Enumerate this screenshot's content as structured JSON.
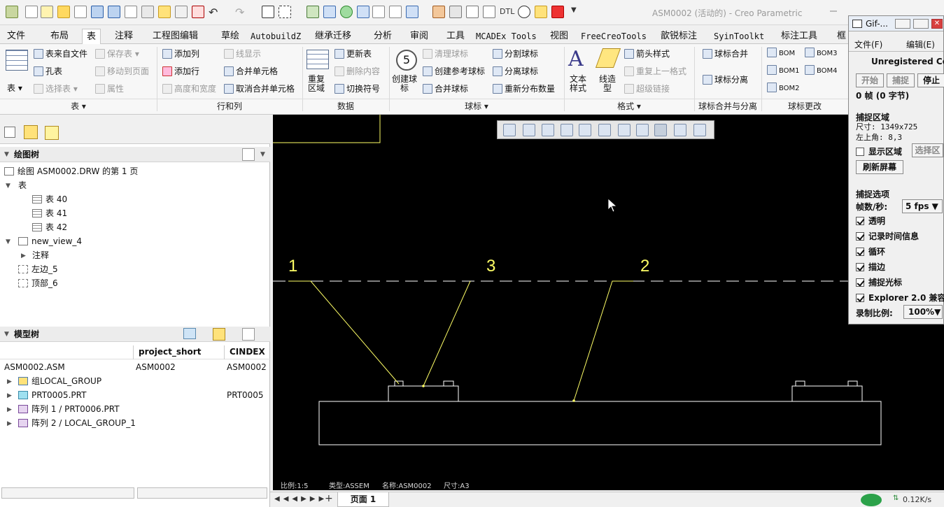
{
  "window": {
    "title": "ASM0002 (活动的) - Creo Parametric"
  },
  "tabs": [
    "文件",
    "布局",
    "表",
    "注释",
    "工程图编辑",
    "草绘",
    "AutobuildZ",
    "继承迁移",
    "分析",
    "审阅",
    "工具",
    "MCADEx Tools",
    "视图",
    "FreeCreoTools",
    "歆锐标注",
    "SyinToolkt",
    "标注工具",
    "框"
  ],
  "active_tab": "表",
  "ribbon": {
    "table": {
      "from_file": "表来自文件",
      "hole_table": "孔表",
      "table": "表",
      "save_table": "保存表",
      "move_to_page": "移动到页面",
      "select_table": "选择表",
      "properties": "属性",
      "add_column": "添加列",
      "add_row": "添加行",
      "height_width": "高度和宽度",
      "line_display": "线显示",
      "merge_cells": "合并单元格",
      "unmerge_cells": "取消合并单元格"
    },
    "data": {
      "repeat_region": "重复\n区域",
      "update_table": "更新表",
      "delete_content": "删除内容",
      "toggle_symbol": "切换符号"
    },
    "balloon": {
      "create_balloon": "创建球\n标",
      "clear_balloon": "清理球标",
      "create_ref_balloon": "创建参考球标",
      "merge_balloon": "合并球标",
      "split_balloon": "分割球标",
      "detach_balloon": "分离球标",
      "redistribute": "重新分布数量",
      "balloon_number": "5"
    },
    "format": {
      "text_style": "文本\n样式",
      "line_style": "线造\n型",
      "arrow_style": "箭头样式",
      "repeat_last_format": "重复上一格式",
      "hyperlink": "超级链接"
    },
    "merge_split": {
      "merge": "球标合并",
      "split": "球标分离"
    },
    "bom_change": {
      "bom": "BOM",
      "bom3": "BOM3",
      "bom1": "BOM1",
      "bom4": "BOM4",
      "bom2": "BOM2"
    },
    "groups": {
      "table": "表",
      "rows_cols": "行和列",
      "data": "数据",
      "balloon": "球标",
      "format": "格式",
      "merge_split": "球标合并与分离",
      "bom_change": "球标更改"
    }
  },
  "drawing_tree": {
    "header": "绘图树",
    "items": [
      {
        "label": "绘图 ASM0002.DRW 的第 1 页"
      },
      {
        "label": "表"
      },
      {
        "label": "表 40"
      },
      {
        "label": "表 41"
      },
      {
        "label": "表 42"
      },
      {
        "label": "new_view_4"
      },
      {
        "label": "注释"
      },
      {
        "label": "左边_5"
      },
      {
        "label": "顶部_6"
      }
    ]
  },
  "model_tree": {
    "header": "模型树",
    "columns": [
      "project_short",
      "CINDEX"
    ],
    "rows": [
      {
        "name": "ASM0002.ASM",
        "project_short": "ASM0002",
        "cindex": "ASM0002"
      },
      {
        "name": "组LOCAL_GROUP",
        "project_short": "",
        "cindex": ""
      },
      {
        "name": "PRT0005.PRT",
        "project_short": "",
        "cindex": "PRT0005"
      },
      {
        "name": "阵列 1 / PRT0006.PRT",
        "project_short": "",
        "cindex": ""
      },
      {
        "name": "阵列 2 / LOCAL_GROUP_1",
        "project_short": "",
        "cindex": ""
      }
    ]
  },
  "canvas": {
    "balloons": [
      "1",
      "3",
      "2"
    ],
    "status": {
      "scale": "比例:1:5",
      "type": "类型:ASSEM",
      "name": "名称:ASM0002",
      "size": "尺寸:A3"
    }
  },
  "pagebar": {
    "page_label": "页面  1",
    "add": "+"
  },
  "gif_recorder": {
    "title": "Gif-...",
    "menu": [
      "文件(F)",
      "编辑(E)"
    ],
    "unregistered": "Unregistered Copy",
    "buttons": [
      "开始",
      "捕捉",
      "停止"
    ],
    "frames": "0 帧 (0 字节)",
    "capture_area": {
      "title": "捕捉区域",
      "size": "尺寸: 1349x725",
      "top_left": "左上角: 8,3",
      "show_area": "显示区域",
      "select_area": "选择区",
      "refresh": "刷新屏幕"
    },
    "capture_options": {
      "title": "捕捉选项",
      "fps_label": "帧数/秒:",
      "fps_value": "5 fps",
      "transparent": "透明",
      "record_time": "记录时间信息",
      "loop": "循环",
      "border": "描边",
      "capture_cursor": "捕捉光标",
      "explorer": "Explorer 2.0 兼容",
      "ratio_label": "录制比例:",
      "ratio_value": "100%"
    }
  },
  "tray": {
    "net_speed": "0.12K/s"
  },
  "colors": {
    "canvas_bg": "#000000",
    "drawing_line": "#ffffff",
    "balloon_leader": "#ffff66",
    "active_tab": "#ffffff"
  }
}
